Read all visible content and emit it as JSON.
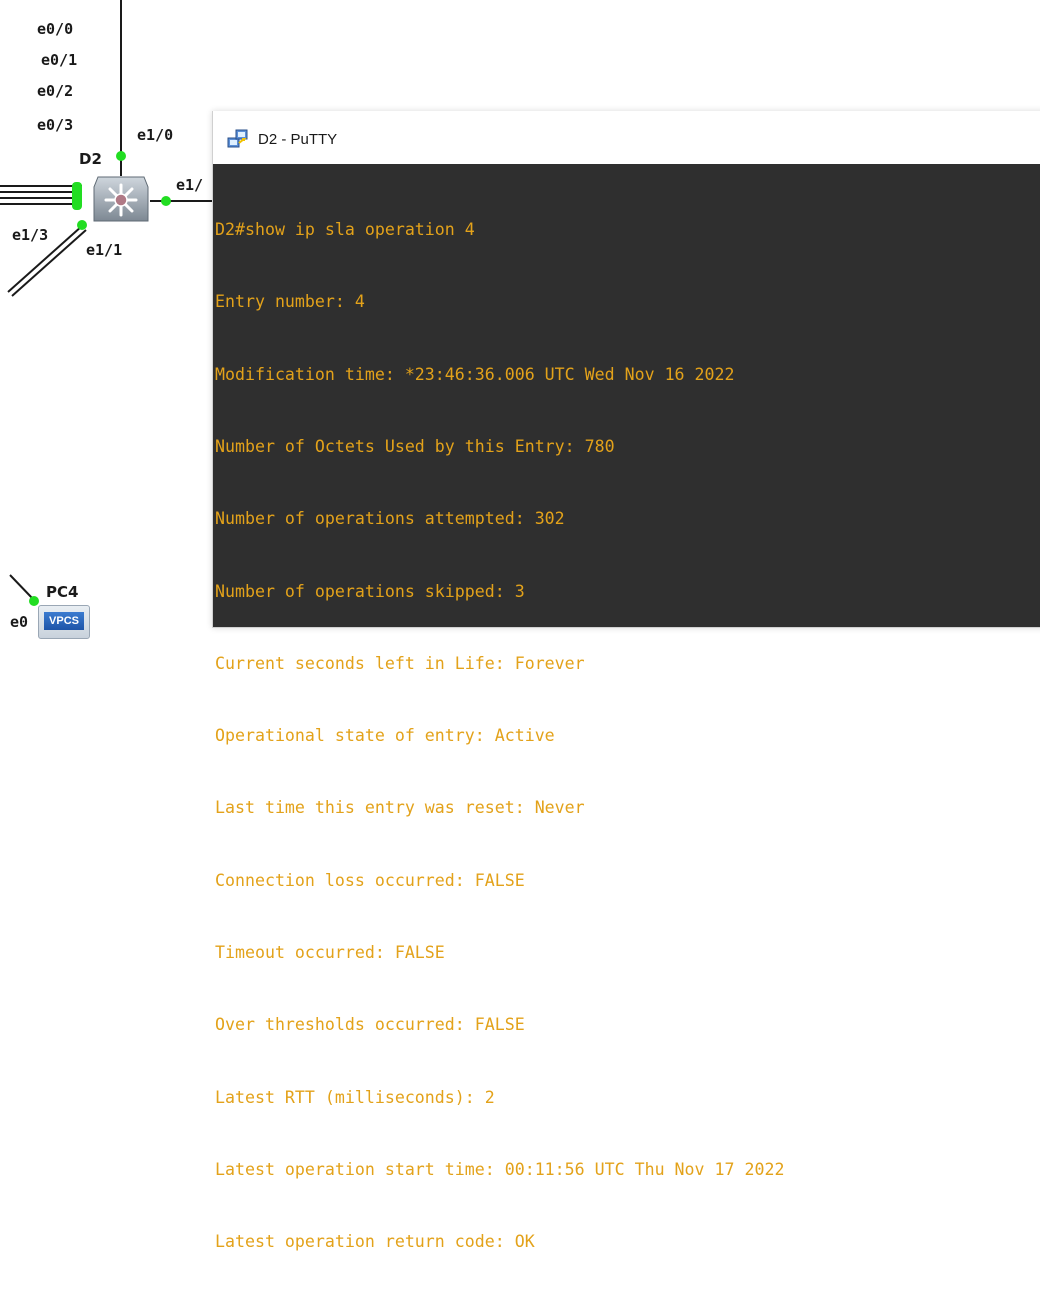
{
  "topology": {
    "switch_name": "D2",
    "switch_ports": [
      "e0/0",
      "e0/1",
      "e0/2",
      "e0/3",
      "e1/0",
      "e1/",
      "e1/3",
      "e1/1"
    ],
    "pc_name": "PC4",
    "pc_port": "e0",
    "pc_icon_label": "VPCS",
    "link_color": "#1a1a1a",
    "link_up_color": "#22dd22"
  },
  "window": {
    "title": "D2 - PuTTY",
    "terminal_bg": "#2f2f2f",
    "terminal_fg": "#e3a21a",
    "lines": [
      "D2#show ip sla operation 4",
      "Entry number: 4",
      "Modification time: *23:46:36.006 UTC Wed Nov 16 2022",
      "Number of Octets Used by this Entry: 780",
      "Number of operations attempted: 302",
      "Number of operations skipped: 3",
      "Current seconds left in Life: Forever",
      "Operational state of entry: Active",
      "Last time this entry was reset: Never",
      "Connection loss occurred: FALSE",
      "Timeout occurred: FALSE",
      "Over thresholds occurred: FALSE",
      "Latest RTT (milliseconds): 2",
      "Latest operation start time: 00:11:56 UTC Thu Nov 17 2022",
      "Latest operation return code: OK"
    ]
  }
}
